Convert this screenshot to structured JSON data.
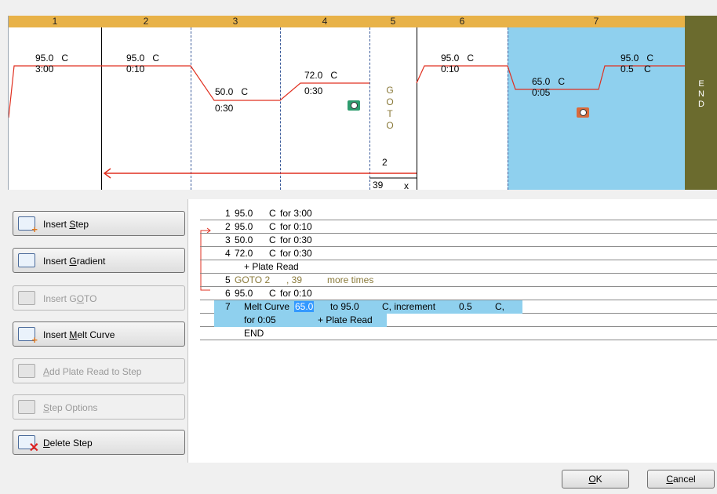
{
  "graph": {
    "steps": [
      {
        "num": "1",
        "temp": "95.0   C",
        "time": "3:00"
      },
      {
        "num": "2",
        "temp": "95.0   C",
        "time": "0:10"
      },
      {
        "num": "3",
        "temp": "50.0   C",
        "time": "0:30"
      },
      {
        "num": "4",
        "temp": "72.0   C",
        "time": "0:30"
      },
      {
        "num": "5"
      },
      {
        "num": "6",
        "temp": "95.0   C",
        "time": "0:10"
      },
      {
        "num": "7",
        "temp_start": "65.0   C",
        "time": "0:05",
        "temp_end": "95.0   C",
        "increment": "0.5    C"
      }
    ],
    "goto_letters": [
      "G",
      "O",
      "T",
      "O"
    ],
    "goto_target": "2",
    "goto_repeat": "39",
    "goto_x": "x",
    "end_letters": [
      "E",
      "N",
      "D"
    ],
    "colors": {
      "header": "#e8b248",
      "melt_highlight": "#8fd0ee",
      "end_bar": "#6b6b2e",
      "trace": "#e03020"
    }
  },
  "buttons": {
    "insert_step": {
      "pre": "Insert ",
      "u": "S",
      "post": "tep",
      "icon": "step-icon"
    },
    "insert_gradient": {
      "pre": "Insert ",
      "u": "G",
      "post": "radient",
      "icon": "gradient-icon"
    },
    "insert_goto": {
      "pre": "Insert G",
      "u": "O",
      "post": "TO",
      "icon": "goto-icon"
    },
    "insert_melt_curve": {
      "pre": "Insert ",
      "u": "M",
      "post": "elt Curve",
      "icon": "melt-curve-icon"
    },
    "add_plate_read": {
      "pre": "",
      "u": "A",
      "post": "dd Plate Read to Step",
      "icon": "camera-icon"
    },
    "step_options": {
      "pre": "",
      "u": "S",
      "post": "tep Options",
      "icon": "step-options-icon"
    },
    "delete_step": {
      "pre": "",
      "u": "D",
      "post": "elete Step",
      "icon": "delete-step-icon"
    }
  },
  "protocol_text": {
    "r1": {
      "num": "1",
      "temp": "95.0",
      "c": "C",
      "for": "for 3:00"
    },
    "r2": {
      "num": "2",
      "temp": "95.0",
      "c": "C",
      "for": "for 0:10"
    },
    "r3": {
      "num": "3",
      "temp": "50.0",
      "c": "C",
      "for": "for 0:30"
    },
    "r4": {
      "num": "4",
      "temp": "72.0",
      "c": "C",
      "for": "for 0:30"
    },
    "r4b": {
      "text": "+ Plate Read"
    },
    "r5": {
      "num": "5",
      "goto": "GOTO 2",
      "times": ", 39",
      "more": "more times"
    },
    "r6": {
      "num": "6",
      "temp": "95.0",
      "c": "C",
      "for": "for 0:10"
    },
    "r7": {
      "num": "7",
      "label": "Melt Curve",
      "start": "65.0",
      "to": "to 95.0",
      "inc_label": "C, increment",
      "inc": "0.5",
      "c": "C,"
    },
    "r7b": {
      "for": "for 0:05",
      "plate": "+ Plate Read"
    },
    "end": {
      "text": "END"
    }
  },
  "dialog": {
    "ok": {
      "u": "O",
      "post": "K"
    },
    "cancel": {
      "u": "C",
      "post": "ancel"
    }
  }
}
